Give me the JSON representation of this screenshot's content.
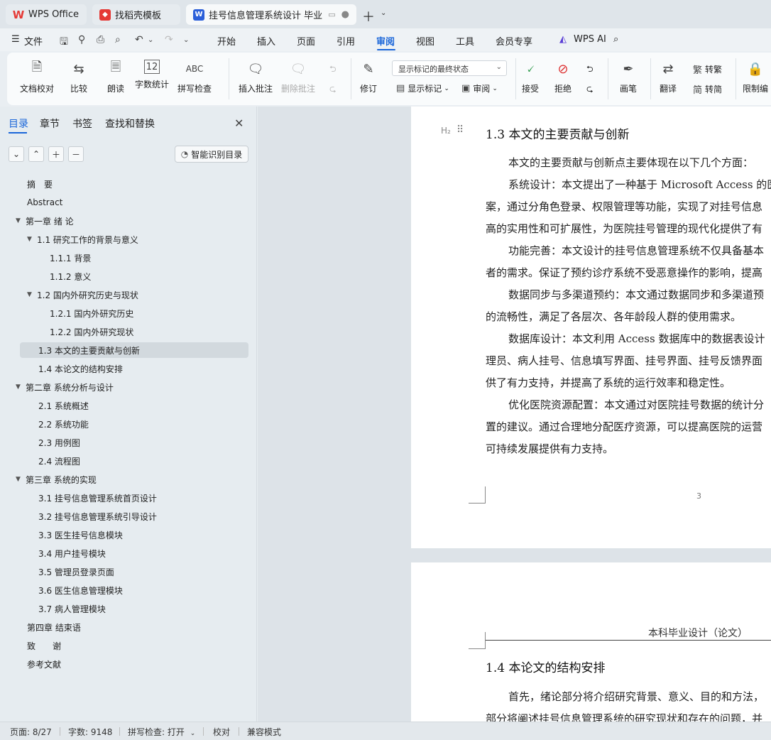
{
  "tabs": [
    {
      "label": "WPS Office",
      "icon": "wps-logo-icon",
      "color": "#e53935"
    },
    {
      "label": "找稻壳模板",
      "icon": "docer-icon",
      "color": "#e53935"
    },
    {
      "label": "挂号信息管理系统设计 毕业论",
      "icon": "writer-doc-icon",
      "color": "#2b5fd9",
      "active": true
    }
  ],
  "menubar": {
    "file_label": "文件",
    "items": [
      "开始",
      "插入",
      "页面",
      "引用",
      "审阅",
      "视图",
      "工具",
      "会员专享"
    ],
    "active": "审阅",
    "wps_ai": "WPS AI"
  },
  "ribbon": {
    "doc_check": "文档校对",
    "compare": "比较",
    "read_aloud": "朗读",
    "word_count": "字数统计",
    "spell_check": "拼写检查",
    "insert_comment": "插入批注",
    "delete_comment": "删除批注",
    "track_changes": "修订",
    "markup_mode": "显示标记的最终状态",
    "show_markup": "显示标记",
    "review_pane": "审阅",
    "accept": "接受",
    "reject": "拒绝",
    "ink": "画笔",
    "translate": "翻译",
    "to_traditional": "转繁",
    "to_simplified": "转简",
    "restrict_editing": "限制编"
  },
  "nav": {
    "tabs": [
      "目录",
      "章节",
      "书签",
      "查找和替换"
    ],
    "smart_toc": "智能识别目录",
    "toc": [
      {
        "label": "摘　要",
        "level": 0
      },
      {
        "label": "Abstract",
        "level": 0
      },
      {
        "label": "第一章 绪 论",
        "level": 0,
        "expanded": true
      },
      {
        "label": "1.1 研究工作的背景与意义",
        "level": 1,
        "expanded": true
      },
      {
        "label": "1.1.1 背景",
        "level": 2
      },
      {
        "label": "1.1.2 意义",
        "level": 2
      },
      {
        "label": "1.2 国内外研究历史与现状",
        "level": 1,
        "expanded": true
      },
      {
        "label": "1.2.1 国内外研究历史",
        "level": 2
      },
      {
        "label": "1.2.2 国内外研究现状",
        "level": 2
      },
      {
        "label": "1.3 本文的主要贡献与创新",
        "level": 1,
        "selected": true
      },
      {
        "label": "1.4 本论文的结构安排",
        "level": 1
      },
      {
        "label": "第二章 系统分析与设计",
        "level": 0,
        "expanded": true
      },
      {
        "label": "2.1 系统概述",
        "level": 1
      },
      {
        "label": "2.2 系统功能",
        "level": 1
      },
      {
        "label": "2.3 用例图",
        "level": 1
      },
      {
        "label": "2.4 流程图",
        "level": 1
      },
      {
        "label": "第三章 系统的实现",
        "level": 0,
        "expanded": true
      },
      {
        "label": "3.1 挂号信息管理系统首页设计",
        "level": 1
      },
      {
        "label": "3.2 挂号信息管理系统引导设计",
        "level": 1
      },
      {
        "label": "3.3 医生挂号信息模块",
        "level": 1
      },
      {
        "label": "3.4 用户挂号模块",
        "level": 1
      },
      {
        "label": "3.5 管理员登录页面",
        "level": 1
      },
      {
        "label": "3.6 医生信息管理模块",
        "level": 1
      },
      {
        "label": "3.7 病人管理模块",
        "level": 1
      },
      {
        "label": "第四章 结束语",
        "level": 0
      },
      {
        "label": "致　　谢",
        "level": 0
      },
      {
        "label": "参考文献",
        "level": 0
      }
    ]
  },
  "document": {
    "h2_marker": "H₂",
    "heading_1_3": "1.3  本文的主要贡献与创新",
    "paragraphs_1_3": [
      "本文的主要贡献与创新点主要体现在以下几个方面：",
      "系统设计：本文提出了一种基于 Microsoft Access 的医",
      "案，通过分角色登录、权限管理等功能，实现了对挂号信息",
      "高的实用性和可扩展性，为医院挂号管理的现代化提供了有",
      "功能完善：本文设计的挂号信息管理系统不仅具备基本",
      "者的需求。保证了预约诊疗系统不受恶意操作的影响，提高",
      "数据同步与多渠道预约：本文通过数据同步和多渠道预",
      "的流畅性，满足了各层次、各年龄段人群的使用需求。",
      "数据库设计：本文利用 Access 数据库中的数据表设计",
      "理员、病人挂号、信息填写界面、挂号界面、挂号反馈界面",
      "供了有力支持，并提高了系统的运行效率和稳定性。",
      "优化医院资源配置：本文通过对医院挂号数据的统计分",
      "置的建议。通过合理地分配医疗资源，可以提高医院的运营",
      "可持续发展提供有力支持。"
    ],
    "page_number": "3",
    "page_header": "本科毕业设计（论文）",
    "heading_1_4": "1.4  本论文的结构安排",
    "paragraphs_1_4": [
      "首先，绪论部分将介绍研究背景、意义、目的和方法，",
      "部分将阐述挂号信息管理系统的研究现状和存在的问题，并"
    ]
  },
  "status": {
    "page": "页面: 8/27",
    "words": "字数: 9148",
    "spell": "拼写检查: 打开",
    "proof": "校对",
    "compat": "兼容模式"
  },
  "colors": {
    "accent": "#1a66d9",
    "wps_red": "#e53935"
  }
}
